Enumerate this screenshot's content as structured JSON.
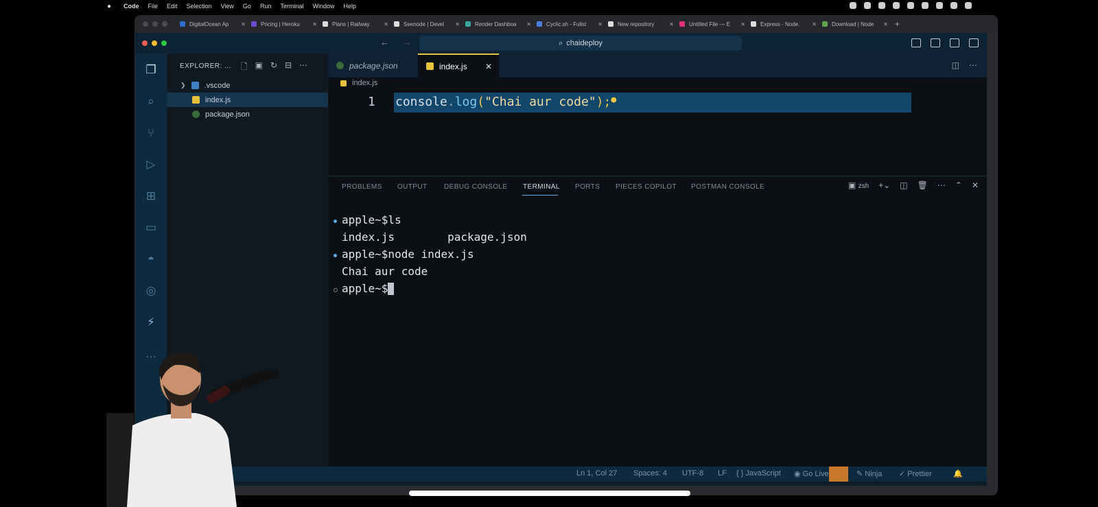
{
  "menubar": {
    "app": "Code",
    "items": [
      "File",
      "Edit",
      "Selection",
      "View",
      "Go",
      "Run",
      "Terminal",
      "Window",
      "Help"
    ]
  },
  "browser_tabs": [
    {
      "label": "DigitalOcean Ap",
      "color": "#2f6fd1"
    },
    {
      "label": "Pricing | Heroku",
      "color": "#6f4bd1"
    },
    {
      "label": "Plans | Railway",
      "color": "#dddddd"
    },
    {
      "label": "Seenode | Devel",
      "color": "#dddddd"
    },
    {
      "label": "Render Dashboa",
      "color": "#3aa6a0"
    },
    {
      "label": "Cyclic.sh - Fullst",
      "color": "#4a7de0"
    },
    {
      "label": "New repository",
      "color": "#dddddd"
    },
    {
      "label": "Untitled File — E",
      "color": "#e0307a"
    },
    {
      "label": "Express - Node.",
      "color": "#dddddd"
    },
    {
      "label": "Download | Node",
      "color": "#5fa04e"
    }
  ],
  "vscode": {
    "search_label": "chaideploy",
    "explorer_title": "EXPLORER: ...",
    "tree": [
      {
        "name": ".vscode",
        "type": "folder"
      },
      {
        "name": "index.js",
        "type": "js",
        "selected": true
      },
      {
        "name": "package.json",
        "type": "json"
      }
    ],
    "editor_tabs": [
      {
        "label": "package.json",
        "active": false
      },
      {
        "label": "index.js",
        "active": true
      }
    ],
    "breadcrumb": "index.js",
    "line_number": "1",
    "code": {
      "part1": "console",
      "part2": ".",
      "part3": "log",
      "part4": "(",
      "part5": "\"Chai aur code\"",
      "part6": ");"
    },
    "panel_tabs": [
      "PROBLEMS",
      "OUTPUT",
      "DEBUG CONSOLE",
      "TERMINAL",
      "PORTS",
      "PIECES COPILOT",
      "POSTMAN CONSOLE"
    ],
    "active_panel_tab": "TERMINAL",
    "shell": "zsh",
    "terminal_lines": [
      {
        "text": "apple~$ls",
        "dot": "filled"
      },
      {
        "text": "index.js        package.json",
        "dot": "none"
      },
      {
        "text": "apple~$node index.js",
        "dot": "filled"
      },
      {
        "text": "Chai aur code",
        "dot": "none"
      },
      {
        "text": "apple~$",
        "dot": "hollow"
      }
    ],
    "status": {
      "position": "Ln 1, Col 27",
      "spaces": "Spaces: 4",
      "encoding": "UTF-8",
      "eol": "LF",
      "language": "{ } JavaScript",
      "golive": "Go Live",
      "ninja": "Ninja",
      "prettier": "Prettier"
    }
  },
  "colors": {
    "accent": "#5aa9e6",
    "selection": "#13466b",
    "activity_bar": "#0e2a3f"
  }
}
